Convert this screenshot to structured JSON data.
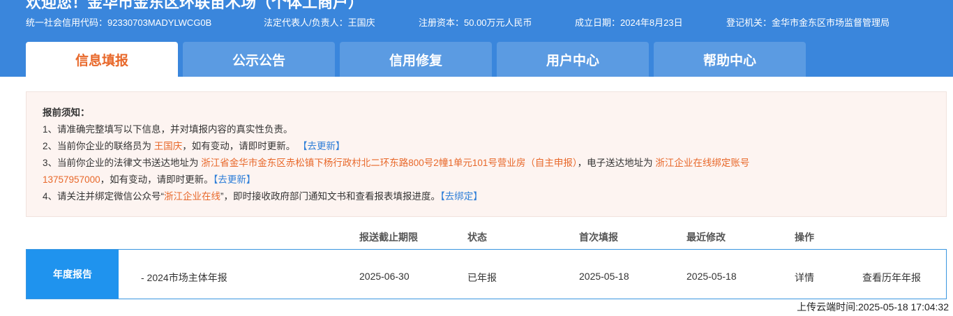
{
  "header": {
    "welcome": "欢迎您！金华市金东区环联苗木场（个体工商户）",
    "credit_code": "统一社会信用代码：92330703MADYLWCG0B",
    "legal_rep": "法定代表人/负责人：王国庆",
    "capital": "注册资本：50.00万元人民币",
    "established": "成立日期：2024年8月23日",
    "authority": "登记机关：金华市金东区市场监督管理局"
  },
  "tabs": [
    {
      "label": "信息填报",
      "active": true
    },
    {
      "label": "公示公告",
      "active": false
    },
    {
      "label": "信用修复",
      "active": false
    },
    {
      "label": "用户中心",
      "active": false
    },
    {
      "label": "帮助中心",
      "active": false
    }
  ],
  "notice": {
    "title": "报前须知：",
    "line1": "1、请准确完整填写以下信息，并对填报内容的真实性负责。",
    "line2_pre": "2、当前你企业的联络员为",
    "line2_name": "王国庆",
    "line2_post": "，如有变动，请即时更新。",
    "line2_link": "【去更新】",
    "line3_pre": "3、当前你企业的法律文书送达地址为",
    "line3_address": "浙江省金华市金东区赤松镇下杨行政村北二环东路800号2幢1单元101号营业房（自主申报）",
    "line3_mid": "，电子送达地址为",
    "line3_esd": "浙江企业在线绑定账号",
    "line3_phone": "13757957000",
    "line3_post": "，如有变动，请即时更新。",
    "line3_link": "【去更新】",
    "line4_pre": "4、请关注并绑定微信公众号“",
    "line4_name": "浙江企业在线",
    "line4_post": "”，即时接收政府部门通知文书和查看报表填报进度。",
    "line4_link": "【去绑定】"
  },
  "table": {
    "headers": {
      "deadline": "报送截止期限",
      "status": "状态",
      "first": "首次填报",
      "modified": "最近修改",
      "action": "操作"
    },
    "report_label": "年度报告",
    "row": {
      "name": "- 2024市场主体年报",
      "deadline": "2025-06-30",
      "status": "已年报",
      "first": "2025-05-18",
      "modified": "2025-05-18",
      "detail": "详情",
      "history": "查看历年年报"
    }
  },
  "footer": {
    "upload_time": "上传云端时间:2025-05-18 17:04:32"
  },
  "colors": {
    "header_bg": "#3a86dc",
    "accent_orange": "#e8682a",
    "link_blue": "#2f7fd8",
    "report_label_bg": "#1f93ee"
  }
}
